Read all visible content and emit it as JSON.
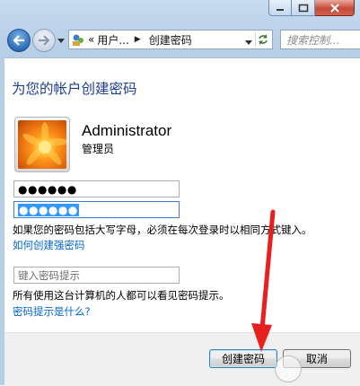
{
  "window": {
    "caption_buttons": [
      "minimize-icon",
      "maximize-icon",
      "close-icon"
    ]
  },
  "navbar": {
    "breadcrumb_prefix": "«",
    "breadcrumb_1": "用户...",
    "breadcrumb_2": "创建密码",
    "search_placeholder": "搜索控制..."
  },
  "main": {
    "title": "为您的帐户创建密码",
    "user_name": "Administrator",
    "user_role": "管理员",
    "password_value": "●●●●●●",
    "confirm_value": "●●●●●●",
    "caps_note": "如果您的密码包括大写字母，必须在每次登录时以相同方式键入。",
    "strong_password_link": "如何创建强密码",
    "hint_placeholder": "键入密码提示",
    "hint_note": "所有使用这台计算机的人都可以看见密码提示。",
    "hint_link": "密码提示是什么?"
  },
  "footer": {
    "create_label": "创建密码",
    "cancel_label": "取消"
  },
  "colors": {
    "title": "#1e3f8c",
    "link": "#0066cc",
    "arrow": "#e8201e",
    "selection": "#3399ff"
  }
}
